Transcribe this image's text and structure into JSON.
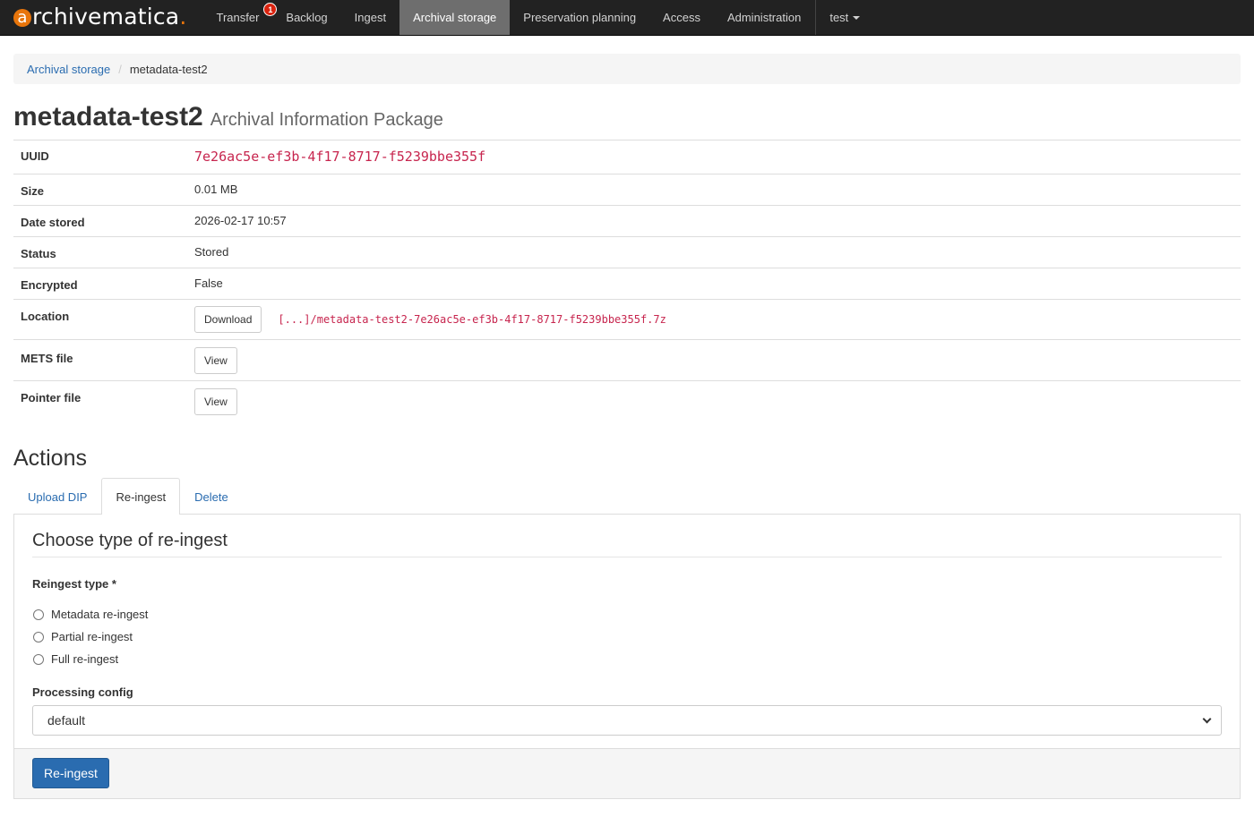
{
  "brand": {
    "first_letter": "a",
    "rest": "rchivematica",
    "dot": "."
  },
  "nav": {
    "items": [
      {
        "label": "Transfer",
        "badge": "1"
      },
      {
        "label": "Backlog"
      },
      {
        "label": "Ingest"
      },
      {
        "label": "Archival storage",
        "active": true
      },
      {
        "label": "Preservation planning"
      },
      {
        "label": "Access"
      },
      {
        "label": "Administration"
      }
    ],
    "user": "test"
  },
  "breadcrumb": {
    "parent": "Archival storage",
    "current": "metadata-test2"
  },
  "header": {
    "title": "metadata-test2",
    "subtitle": "Archival Information Package"
  },
  "details": {
    "uuid_label": "UUID",
    "uuid": "7e26ac5e-ef3b-4f17-8717-f5239bbe355f",
    "size_label": "Size",
    "size": "0.01 MB",
    "date_label": "Date stored",
    "date": "2026-02-17 10:57",
    "status_label": "Status",
    "status": "Stored",
    "encrypted_label": "Encrypted",
    "encrypted": "False",
    "location_label": "Location",
    "download_label": "Download",
    "location_path": "[...]/metadata-test2-7e26ac5e-ef3b-4f17-8717-f5239bbe355f.7z",
    "mets_label": "METS file",
    "mets_button": "View",
    "pointer_label": "Pointer file",
    "pointer_button": "View"
  },
  "actions": {
    "title": "Actions",
    "tabs": [
      {
        "label": "Upload DIP"
      },
      {
        "label": "Re-ingest",
        "active": true
      },
      {
        "label": "Delete"
      }
    ],
    "form": {
      "legend": "Choose type of re-ingest",
      "type_label": "Reingest type *",
      "options": [
        "Metadata re-ingest",
        "Partial re-ingest",
        "Full re-ingest"
      ],
      "config_label": "Processing config",
      "config_value": "default",
      "submit_label": "Re-ingest"
    }
  },
  "colors": {
    "navbar": "#222222",
    "accent": "#2a6cb0",
    "brand_orange": "#e8750b",
    "code": "#c7254e"
  }
}
